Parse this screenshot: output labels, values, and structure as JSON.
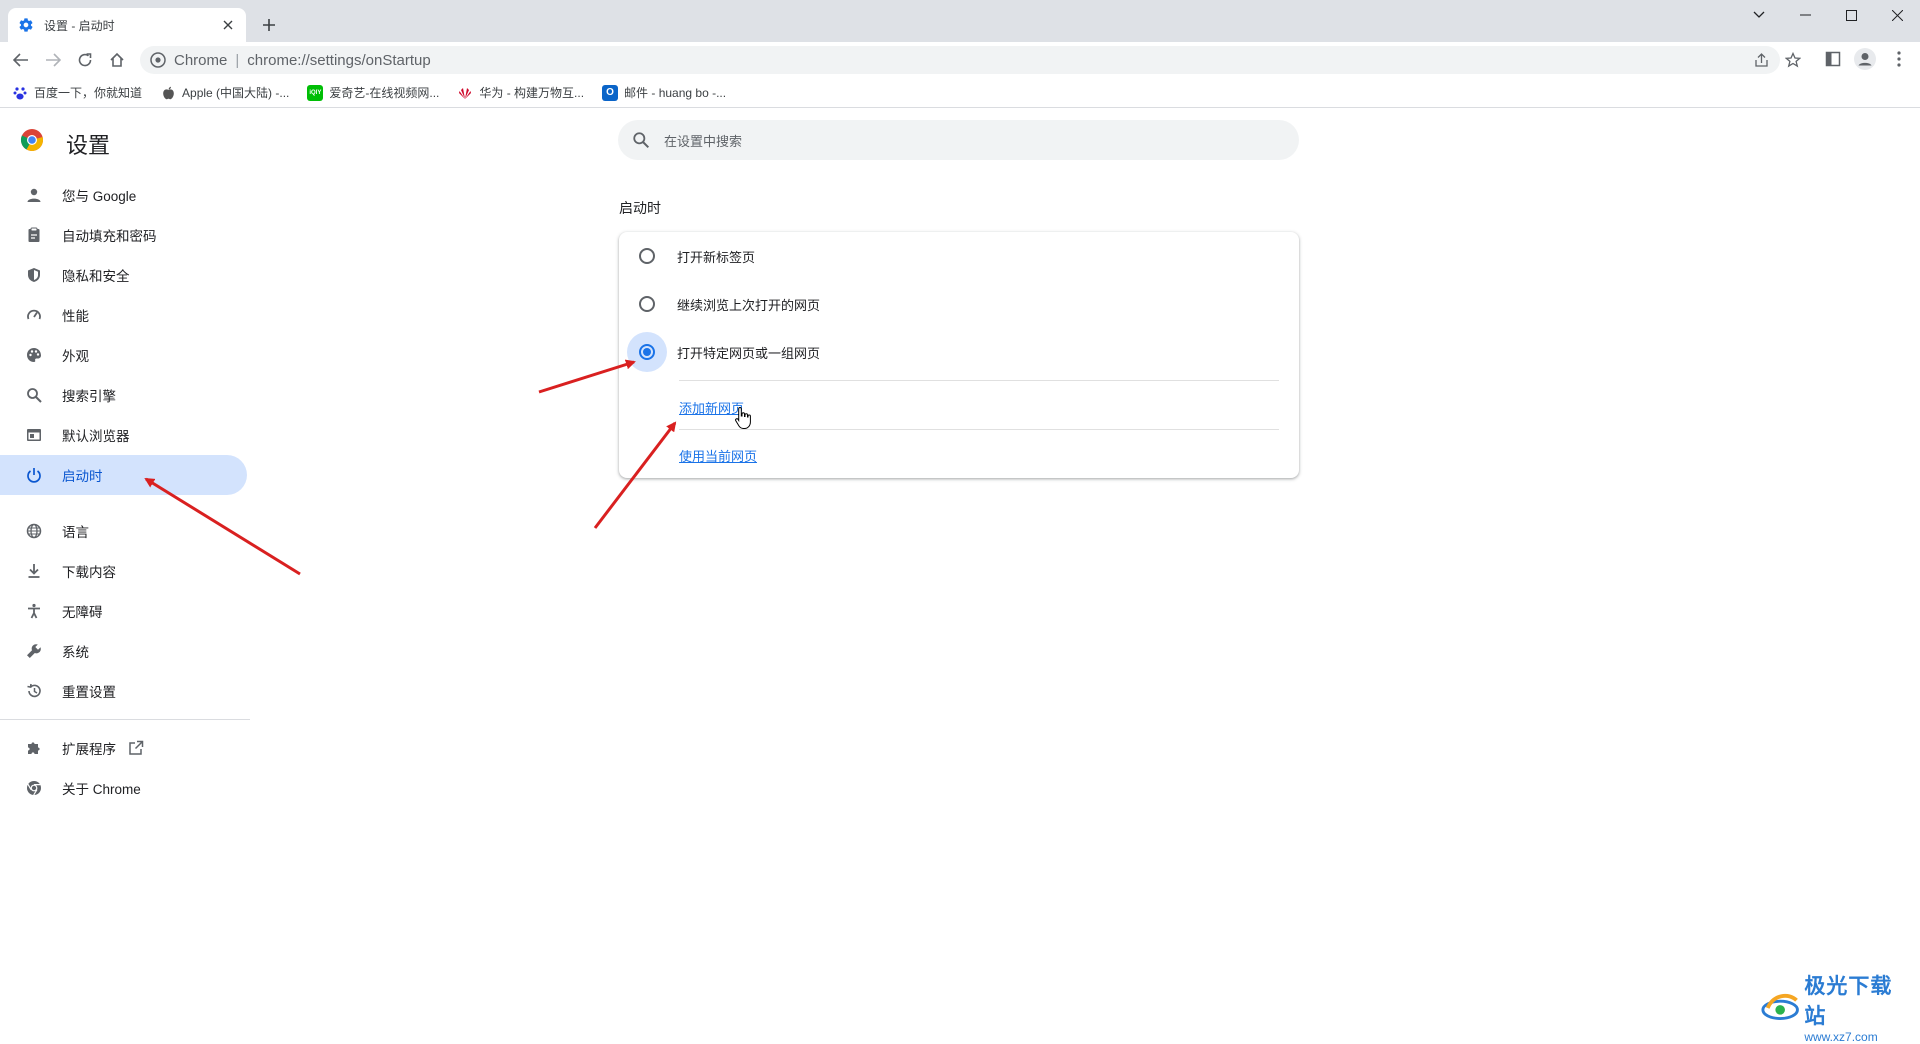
{
  "browser": {
    "tab_title": "设置 - 启动时",
    "site_name": "Chrome",
    "url": "chrome://settings/onStartup"
  },
  "bookmarks": [
    {
      "label": "百度一下，你就知道",
      "icon": "baidu-icon",
      "color": "#2932e1"
    },
    {
      "label": "Apple (中国大陆) -...",
      "icon": "apple-icon",
      "color": "#555555"
    },
    {
      "label": "爱奇艺-在线视频网...",
      "icon": "iqiyi-icon",
      "color": "#00be06"
    },
    {
      "label": "华为 - 构建万物互...",
      "icon": "huawei-icon",
      "color": "#cf0a2c"
    },
    {
      "label": "邮件 - huang bo -...",
      "icon": "outlook-icon",
      "color": "#0a64c8"
    }
  ],
  "settings": {
    "title": "设置",
    "search_placeholder": "在设置中搜索"
  },
  "sidebar": {
    "items": [
      {
        "label": "您与 Google",
        "icon": "person-icon"
      },
      {
        "label": "自动填充和密码",
        "icon": "clipboard-icon"
      },
      {
        "label": "隐私和安全",
        "icon": "shield-icon"
      },
      {
        "label": "性能",
        "icon": "speedometer-icon"
      },
      {
        "label": "外观",
        "icon": "palette-icon"
      },
      {
        "label": "搜索引擎",
        "icon": "search-icon"
      },
      {
        "label": "默认浏览器",
        "icon": "browser-icon"
      },
      {
        "label": "启动时",
        "icon": "power-icon",
        "active": true
      }
    ],
    "advanced_items": [
      {
        "label": "语言",
        "icon": "globe-icon"
      },
      {
        "label": "下载内容",
        "icon": "download-icon"
      },
      {
        "label": "无障碍",
        "icon": "accessibility-icon"
      },
      {
        "label": "系统",
        "icon": "wrench-icon"
      },
      {
        "label": "重置设置",
        "icon": "history-icon"
      }
    ],
    "extra_items": [
      {
        "label": "扩展程序",
        "icon": "puzzle-icon"
      },
      {
        "label": "关于 Chrome",
        "icon": "chrome-icon"
      }
    ]
  },
  "startup": {
    "section_title": "启动时",
    "options": [
      {
        "label": "打开新标签页",
        "selected": false
      },
      {
        "label": "继续浏览上次打开的网页",
        "selected": false
      },
      {
        "label": "打开特定网页或一组网页",
        "selected": true
      }
    ],
    "add_page_link": "添加新网页",
    "use_current_link": "使用当前网页"
  },
  "watermark": {
    "main": "极光下载站",
    "sub": "www.xz7.com"
  },
  "colors": {
    "accent": "#1a73e8",
    "active_bg": "#d3e3fd",
    "annotation_arrow": "#d92020"
  }
}
